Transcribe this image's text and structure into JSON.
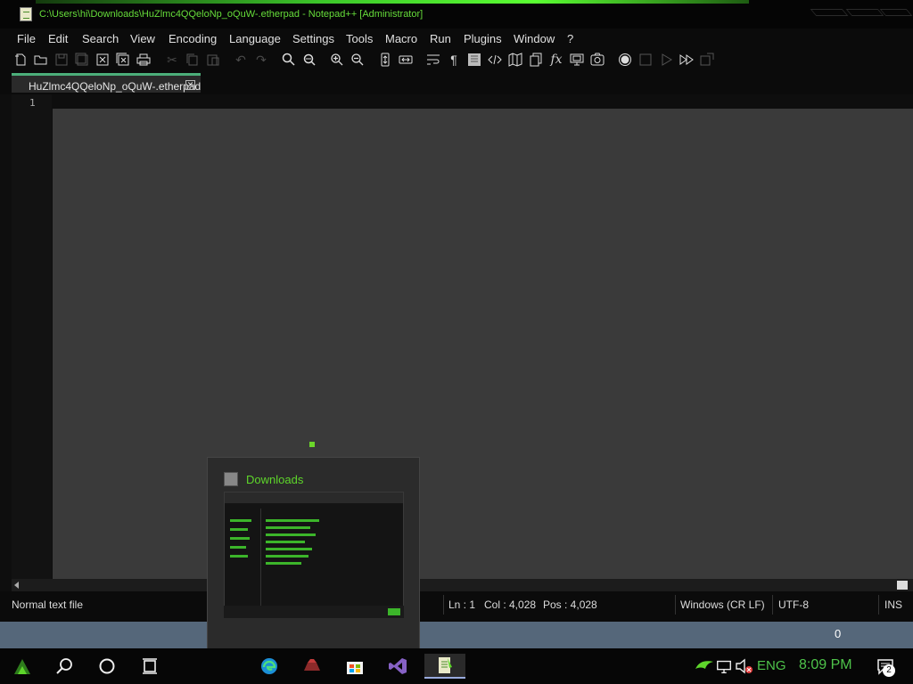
{
  "window": {
    "title": "C:\\Users\\hi\\Downloads\\HuZlmc4QQeloNp_oQuW-.etherpad - Notepad++ [Administrator]",
    "accent_color": "#5aff32"
  },
  "menu": [
    "File",
    "Edit",
    "Search",
    "View",
    "Encoding",
    "Language",
    "Settings",
    "Tools",
    "Macro",
    "Run",
    "Plugins",
    "Window",
    "?"
  ],
  "toolbar": {
    "icons": [
      "new-file-icon",
      "open-file-icon",
      "save-icon",
      "save-all-icon",
      "close-icon",
      "close-all-icon",
      "print-icon",
      "cut-icon",
      "copy-icon",
      "paste-icon",
      "undo-icon",
      "redo-icon",
      "find-icon",
      "replace-icon",
      "zoom-in-icon",
      "zoom-out-icon",
      "sync-vertical-icon",
      "sync-horizontal-icon",
      "word-wrap-icon",
      "show-all-characters-icon",
      "indent-guide-icon",
      "xml-tag-icon",
      "document-map-icon",
      "document-list-icon",
      "function-list-icon",
      "folder-as-workspace-icon",
      "monitoring-icon",
      "record-macro-icon",
      "stop-record-icon",
      "play-macro-icon",
      "run-macro-multiple-icon",
      "save-macro-icon"
    ]
  },
  "tabs": [
    {
      "label": "HuZlmc4QQeloNp_oQuW-.etherpad",
      "active": true
    }
  ],
  "editor": {
    "line_numbers": [
      "1"
    ],
    "background": "#3a3a3a"
  },
  "status": {
    "file_type": "Normal text file",
    "line": "Ln : 1",
    "column": "Col : 4,028",
    "position": "Pos : 4,028",
    "eol": "Windows (CR LF)",
    "encoding": "UTF-8",
    "mode": "INS"
  },
  "desktop": {
    "counter": "0"
  },
  "thumbnail": {
    "title": "Downloads"
  },
  "taskbar": {
    "apps": [
      "start-icon",
      "search-icon",
      "cortana-icon",
      "task-view-icon",
      "edge-icon",
      "gaming-app-icon",
      "store-icon",
      "visual-studio-icon",
      "notepad-plus-plus-icon"
    ],
    "tray_icons": [
      "rog-icon",
      "network-icon",
      "volume-muted-icon"
    ],
    "language": "ENG",
    "time": "8:09 PM",
    "notifications_count": "2"
  }
}
